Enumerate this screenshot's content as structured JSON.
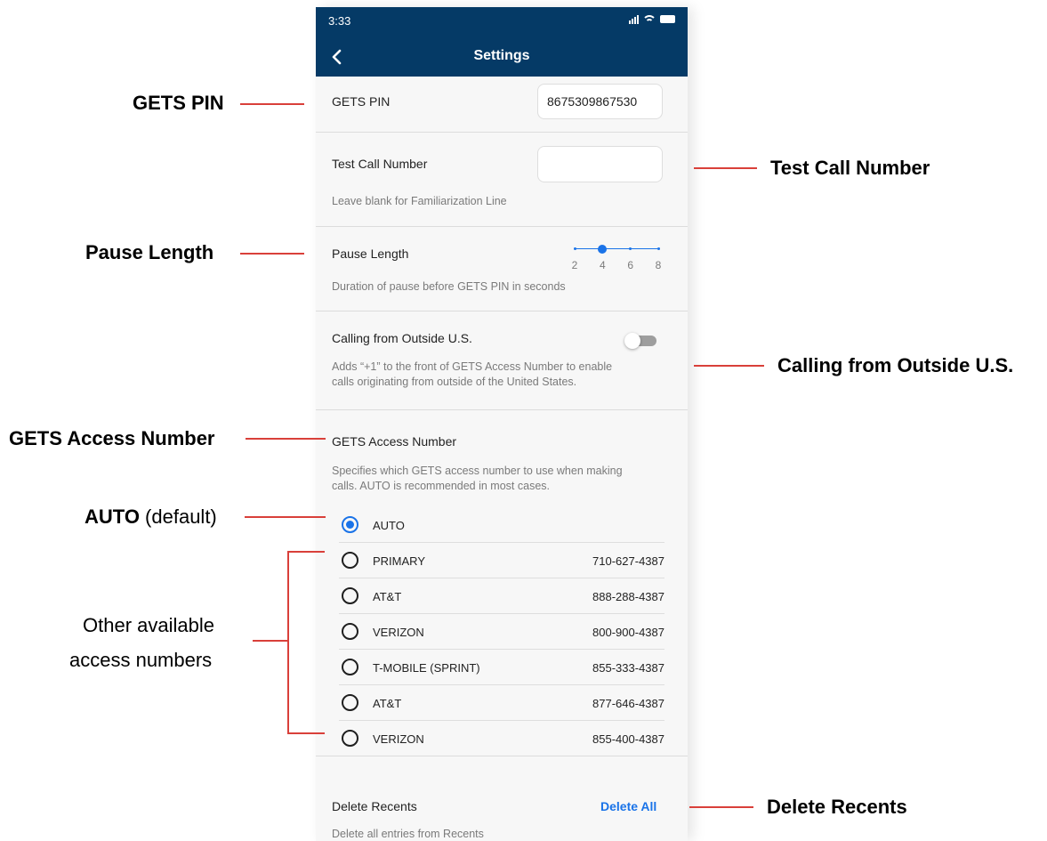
{
  "status_bar": {
    "time": "3:33"
  },
  "app_bar": {
    "title": "Settings",
    "back_icon": "chevron-left-icon"
  },
  "gets_pin": {
    "label": "GETS PIN",
    "value": "8675309867530"
  },
  "test_call": {
    "label": "Test Call Number",
    "value": "",
    "description": "Leave blank for Familiarization Line"
  },
  "pause_length": {
    "label": "Pause Length",
    "ticks": [
      "2",
      "4",
      "6",
      "8"
    ],
    "selected": 4,
    "description": "Duration of pause before GETS PIN in seconds"
  },
  "outside_us": {
    "label": "Calling from Outside U.S.",
    "enabled": false,
    "description_line1": "Adds “+1” to the front of GETS Access Number to enable",
    "description_line2": "calls originating from outside of the United States."
  },
  "access_number": {
    "label": "GETS Access Number",
    "description_line1": "Specifies which GETS access number to use when making",
    "description_line2": "calls. AUTO is recommended in most cases.",
    "options": [
      {
        "name": "AUTO",
        "number": "",
        "selected": true
      },
      {
        "name": "PRIMARY",
        "number": "710-627-4387",
        "selected": false
      },
      {
        "name": "AT&T",
        "number": "888-288-4387",
        "selected": false
      },
      {
        "name": "VERIZON",
        "number": "800-900-4387",
        "selected": false
      },
      {
        "name": "T-MOBILE (SPRINT)",
        "number": "855-333-4387",
        "selected": false
      },
      {
        "name": "AT&T",
        "number": "877-646-4387",
        "selected": false
      },
      {
        "name": "VERIZON",
        "number": "855-400-4387",
        "selected": false
      }
    ]
  },
  "delete_recents": {
    "label": "Delete Recents",
    "action": "Delete All",
    "description": "Delete all entries from Recents"
  },
  "annotations": {
    "gets_pin": "GETS PIN",
    "test_call": "Test Call Number",
    "pause_length": "Pause Length",
    "outside_us": "Calling from Outside U.S.",
    "access_number": "GETS Access Number",
    "auto_bold": "AUTO",
    "auto_rest": " (default)",
    "other_line1": "Other available",
    "other_line2": "access numbers",
    "delete_recents": "Delete Recents"
  },
  "colors": {
    "header": "#053a66",
    "accent": "#1a73e8",
    "annotation_line": "#d9403a",
    "toggle_off": "#9e9e9e"
  }
}
